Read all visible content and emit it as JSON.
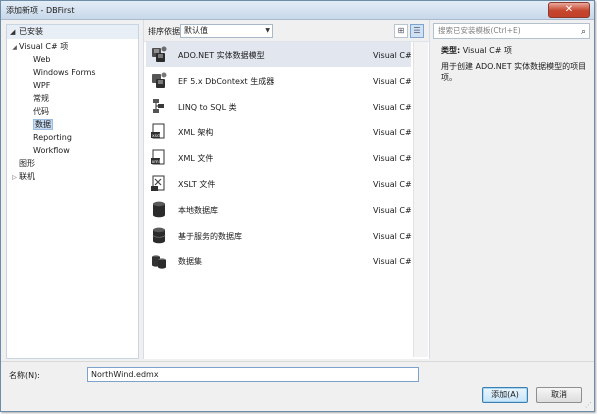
{
  "window": {
    "title": "添加新项 - DBFirst",
    "close_label": "✕"
  },
  "left_panel": {
    "header": "已安装",
    "tree": [
      {
        "label": "Visual C# 项",
        "level": 0,
        "expander": "◢"
      },
      {
        "label": "Web",
        "level": 1
      },
      {
        "label": "Windows Forms",
        "level": 1
      },
      {
        "label": "WPF",
        "level": 1
      },
      {
        "label": "常规",
        "level": 1
      },
      {
        "label": "代码",
        "level": 1
      },
      {
        "label": "数据",
        "level": 1,
        "selected": true
      },
      {
        "label": "Reporting",
        "level": 1
      },
      {
        "label": "Workflow",
        "level": 1
      },
      {
        "label": "图形",
        "level": 0,
        "expander": ""
      },
      {
        "label": "联机",
        "level": 0,
        "expander": "▷"
      }
    ]
  },
  "toolbar": {
    "sort_label": "排序依据:",
    "sort_value": "默认值",
    "views": [
      {
        "icon": "grid-view-icon",
        "glyph": "⊞",
        "active": false
      },
      {
        "icon": "list-view-icon",
        "glyph": "☰",
        "active": true
      }
    ]
  },
  "templates": [
    {
      "name": "ADO.NET 实体数据模型",
      "type": "Visual C# 项",
      "icon": "entity-model-icon",
      "selected": true
    },
    {
      "name": "EF 5.x DbContext 生成器",
      "type": "Visual C# 项",
      "icon": "dbcontext-generator-icon"
    },
    {
      "name": "LINQ to SQL 类",
      "type": "Visual C# 项",
      "icon": "linq-to-sql-icon"
    },
    {
      "name": "XML 架构",
      "type": "Visual C# 项",
      "icon": "xml-schema-icon"
    },
    {
      "name": "XML 文件",
      "type": "Visual C# 项",
      "icon": "xml-file-icon"
    },
    {
      "name": "XSLT 文件",
      "type": "Visual C# 项",
      "icon": "xslt-file-icon"
    },
    {
      "name": "本地数据库",
      "type": "Visual C# 项",
      "icon": "local-database-icon"
    },
    {
      "name": "基于服务的数据库",
      "type": "Visual C# 项",
      "icon": "service-database-icon"
    },
    {
      "name": "数据集",
      "type": "Visual C# 项",
      "icon": "dataset-icon"
    }
  ],
  "search": {
    "placeholder": "搜索已安装模板(Ctrl+E)",
    "icon": "search-icon"
  },
  "details": {
    "type_label": "类型:",
    "type_value": "Visual C# 项",
    "description": "用于创建 ADO.NET 实体数据模型的项目项。"
  },
  "name_field": {
    "label": "名称(N):",
    "value": "NorthWind.edmx"
  },
  "buttons": {
    "add": "添加(A)",
    "cancel": "取消"
  }
}
